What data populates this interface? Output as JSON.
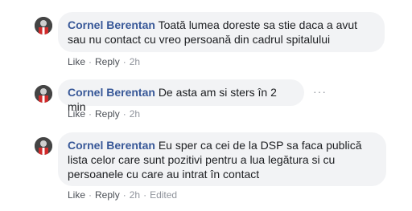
{
  "icons": {
    "avatar": "avatar-icon",
    "more": "more-options-icon"
  },
  "labels": {
    "like": "Like",
    "reply": "Reply",
    "separator": "·",
    "more": "···",
    "edited": "Edited"
  },
  "colors": {
    "author": "#385898",
    "bubble": "#f2f3f5",
    "meta": "#90949c"
  },
  "comments": [
    {
      "author": "Cornel Berentan",
      "text_line1": "Toată lumea doreste sa stie daca a avut",
      "text_line2": "sau nu contact cu vreo persoană din cadrul spitalului",
      "time": "2h"
    },
    {
      "author": "Cornel Berentan",
      "text_line1": "De asta am si sters în 2 min",
      "time": "2h"
    },
    {
      "author": "Cornel Berentan",
      "text_line1": "Eu sper ca cei de la DSP sa faca publică",
      "text_line2": "lista celor care sunt pozitivi pentru a lua legătura si cu",
      "text_line3": "persoanele cu care au intrat în contact",
      "time": "2h",
      "edited": true
    }
  ]
}
